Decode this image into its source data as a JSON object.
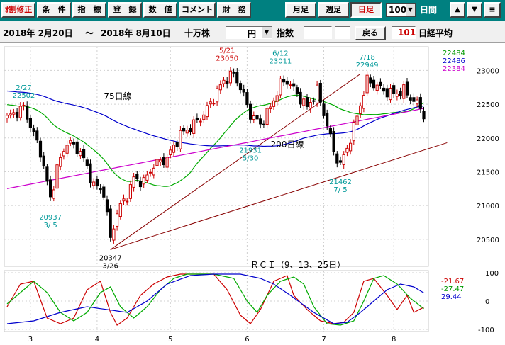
{
  "toolbar": {
    "buttons": [
      "ｵ割修正",
      "条　件",
      "指　標",
      "登　録",
      "数　値",
      "コメント",
      "財　務"
    ],
    "periods": [
      "月足",
      "週足",
      "日足"
    ],
    "count_value": "100",
    "count_unit": "日間",
    "up_icon": "▲",
    "down_icon": "▼",
    "menu_icon": "≡"
  },
  "toolbar2": {
    "date_from": "2018年 2月20日",
    "tilde": "～",
    "date_to": "2018年 8月10日",
    "unit": "十万株",
    "currency": "円",
    "dropdown_icon": "▼",
    "index_label": "指数",
    "back_button": "戻る",
    "code": "101",
    "name": "日経平均"
  },
  "colors": {
    "toolbar_bg": "#008080",
    "up_candle": "#cc0000",
    "down_candle": "#000000",
    "ma75": "#0000cc",
    "ma25": "#00aa00",
    "ma200": "#cc00cc",
    "rci9": "#cc0000",
    "rci13": "#00aa00",
    "rci25": "#0000cc",
    "annotation_cyan": "#009999",
    "annotation_red": "#cc0000"
  },
  "chart_data": [
    {
      "type": "candlestick",
      "x_tick_labels": [
        "3",
        "4",
        "5",
        "6",
        "7",
        "8"
      ],
      "y_ticks": [
        20500,
        21000,
        21500,
        22000,
        22500,
        23000
      ],
      "ylim": [
        20100,
        23350
      ],
      "right_values": [
        {
          "value": "22484",
          "color": "#009900"
        },
        {
          "value": "22486",
          "color": "#0000cc"
        },
        {
          "value": "22384",
          "color": "#cc00cc"
        }
      ],
      "line_labels": [
        "75日線",
        "200日線"
      ],
      "annotations": [
        {
          "date": "2/27",
          "price": "22502"
        },
        {
          "date": "3/ 5",
          "price": "20937"
        },
        {
          "date": "3/26",
          "price": "20347"
        },
        {
          "date": "5/21",
          "price": "23050"
        },
        {
          "date": "5/30",
          "price": "21931"
        },
        {
          "date": "6/12",
          "price": "23011"
        },
        {
          "date": "7/ 5",
          "price": "21462"
        },
        {
          "date": "7/18",
          "price": "22949"
        }
      ],
      "anchor_prices": [
        [
          0,
          22300
        ],
        [
          5,
          22450
        ],
        [
          8,
          22050
        ],
        [
          10,
          21800
        ],
        [
          13,
          21100
        ],
        [
          15,
          21550
        ],
        [
          18,
          21950
        ],
        [
          22,
          21800
        ],
        [
          26,
          21300
        ],
        [
          29,
          21200
        ],
        [
          31,
          20500
        ],
        [
          33,
          20900
        ],
        [
          36,
          21150
        ],
        [
          38,
          21400
        ],
        [
          41,
          21350
        ],
        [
          44,
          21600
        ],
        [
          48,
          21700
        ],
        [
          52,
          22050
        ],
        [
          56,
          22200
        ],
        [
          59,
          22350
        ],
        [
          62,
          22600
        ],
        [
          65,
          22850
        ],
        [
          68,
          22950
        ],
        [
          70,
          22750
        ],
        [
          73,
          22350
        ],
        [
          76,
          22200
        ],
        [
          79,
          22450
        ],
        [
          82,
          22800
        ],
        [
          84,
          22850
        ],
        [
          87,
          22650
        ],
        [
          90,
          22450
        ],
        [
          93,
          22700
        ],
        [
          96,
          22200
        ],
        [
          98,
          21800
        ],
        [
          100,
          21600
        ],
        [
          102,
          21850
        ],
        [
          104,
          22150
        ],
        [
          106,
          22500
        ],
        [
          108,
          22850
        ],
        [
          110,
          22800
        ],
        [
          113,
          22700
        ],
        [
          116,
          22650
        ],
        [
          119,
          22700
        ],
        [
          122,
          22550
        ],
        [
          124,
          22450
        ],
        [
          125,
          22350
        ]
      ]
    },
    {
      "type": "line",
      "title": "ＲＣＩ（9、13、25日）",
      "y_ticks": [
        100,
        0,
        -100
      ],
      "ylim": [
        -100,
        100
      ],
      "right_values": [
        {
          "value": "-21.67",
          "color": "#cc0000"
        },
        {
          "value": "-27.47",
          "color": "#009900"
        },
        {
          "value": "29.44",
          "color": "#0000cc"
        }
      ],
      "series": [
        {
          "points": [
            [
              0,
              -20
            ],
            [
              4,
              60
            ],
            [
              8,
              70
            ],
            [
              12,
              -60
            ],
            [
              16,
              -80
            ],
            [
              20,
              -60
            ],
            [
              24,
              40
            ],
            [
              28,
              70
            ],
            [
              31,
              -40
            ],
            [
              33,
              -85
            ],
            [
              36,
              -60
            ],
            [
              40,
              20
            ],
            [
              44,
              60
            ],
            [
              48,
              85
            ],
            [
              52,
              95
            ],
            [
              58,
              95
            ],
            [
              62,
              95
            ],
            [
              66,
              40
            ],
            [
              70,
              -50
            ],
            [
              73,
              -80
            ],
            [
              76,
              -30
            ],
            [
              80,
              70
            ],
            [
              84,
              90
            ],
            [
              86,
              20
            ],
            [
              90,
              -30
            ],
            [
              94,
              -70
            ],
            [
              98,
              -80
            ],
            [
              101,
              -75
            ],
            [
              104,
              -40
            ],
            [
              107,
              70
            ],
            [
              110,
              80
            ],
            [
              114,
              20
            ],
            [
              117,
              -30
            ],
            [
              120,
              20
            ],
            [
              122,
              -40
            ],
            [
              125,
              -22
            ]
          ]
        },
        {
          "points": [
            [
              0,
              -10
            ],
            [
              4,
              30
            ],
            [
              8,
              70
            ],
            [
              12,
              30
            ],
            [
              16,
              -40
            ],
            [
              20,
              -70
            ],
            [
              24,
              -40
            ],
            [
              28,
              30
            ],
            [
              31,
              50
            ],
            [
              34,
              -20
            ],
            [
              38,
              -60
            ],
            [
              42,
              -20
            ],
            [
              46,
              40
            ],
            [
              50,
              80
            ],
            [
              54,
              95
            ],
            [
              62,
              95
            ],
            [
              68,
              80
            ],
            [
              72,
              0
            ],
            [
              75,
              -40
            ],
            [
              78,
              20
            ],
            [
              82,
              70
            ],
            [
              86,
              85
            ],
            [
              89,
              60
            ],
            [
              92,
              -20
            ],
            [
              96,
              -80
            ],
            [
              100,
              -85
            ],
            [
              104,
              -70
            ],
            [
              107,
              0
            ],
            [
              110,
              80
            ],
            [
              113,
              90
            ],
            [
              117,
              60
            ],
            [
              121,
              10
            ],
            [
              125,
              -27
            ]
          ]
        },
        {
          "points": [
            [
              0,
              -80
            ],
            [
              8,
              -70
            ],
            [
              16,
              -40
            ],
            [
              24,
              -20
            ],
            [
              30,
              -30
            ],
            [
              36,
              -40
            ],
            [
              42,
              0
            ],
            [
              48,
              60
            ],
            [
              55,
              90
            ],
            [
              62,
              95
            ],
            [
              70,
              95
            ],
            [
              76,
              80
            ],
            [
              80,
              60
            ],
            [
              85,
              20
            ],
            [
              92,
              -40
            ],
            [
              98,
              -80
            ],
            [
              102,
              -75
            ],
            [
              106,
              -40
            ],
            [
              110,
              0
            ],
            [
              114,
              40
            ],
            [
              118,
              60
            ],
            [
              122,
              50
            ],
            [
              125,
              29
            ]
          ]
        }
      ]
    }
  ]
}
